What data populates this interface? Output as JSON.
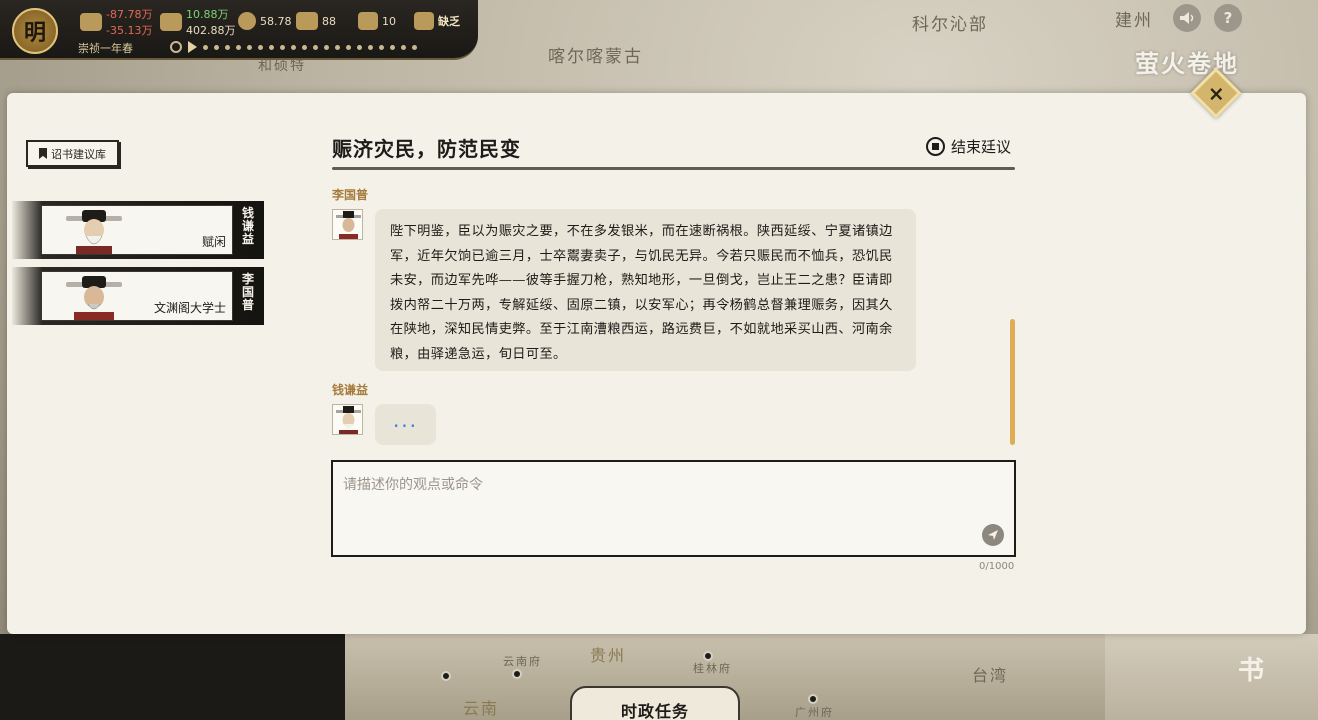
{
  "hud": {
    "dynasty": "明",
    "silver_delta": "-87.78万",
    "silver_total": "-35.13万",
    "grain_delta": "10.88万",
    "grain_total": "402.88万",
    "stat3": "58.78",
    "stat4": "88",
    "stat5": "10",
    "status": "缺乏",
    "date": "崇祯一年春"
  },
  "map": {
    "labels": [
      "科尔沁部",
      "喀尔喀蒙古",
      "建州",
      "和硕特",
      "贵州",
      "云南府",
      "桂林府",
      "云南",
      "台湾",
      "广州府"
    ],
    "watermark": "萤火卷地",
    "book_label": "书",
    "task_button": "时政任务"
  },
  "sidebar": {
    "edict_library": "诏书建议库",
    "ministers": [
      {
        "name": "钱谦益",
        "title": "赋闲"
      },
      {
        "name": "李国普",
        "title": "文渊阁大学士"
      }
    ]
  },
  "court": {
    "title": "赈济灾民，防范民变",
    "end_label": "结束廷议",
    "messages": [
      {
        "speaker": "李国普",
        "text": "陛下明鉴，臣以为赈灾之要，不在多发银米，而在速断祸根。陕西延绥、宁夏诸镇边军，近年欠饷已逾三月，士卒鬻妻卖子，与饥民无异。今若只赈民而不恤兵，恐饥民未安，而边军先哗——彼等手握刀枪，熟知地形，一旦倒戈，岂止王二之患？臣请即拨内帑二十万两，专解延绥、固原二镇，以安军心；再令杨鹤总督兼理赈务，因其久在陕地，深知民情吏弊。至于江南漕粮西运，路远费巨，不如就地采买山西、河南余粮，由驿递急运，旬日可至。"
      },
      {
        "speaker": "钱谦益",
        "text": "..."
      }
    ]
  },
  "input": {
    "placeholder": "请描述你的观点或命令",
    "counter": "0/1000"
  }
}
